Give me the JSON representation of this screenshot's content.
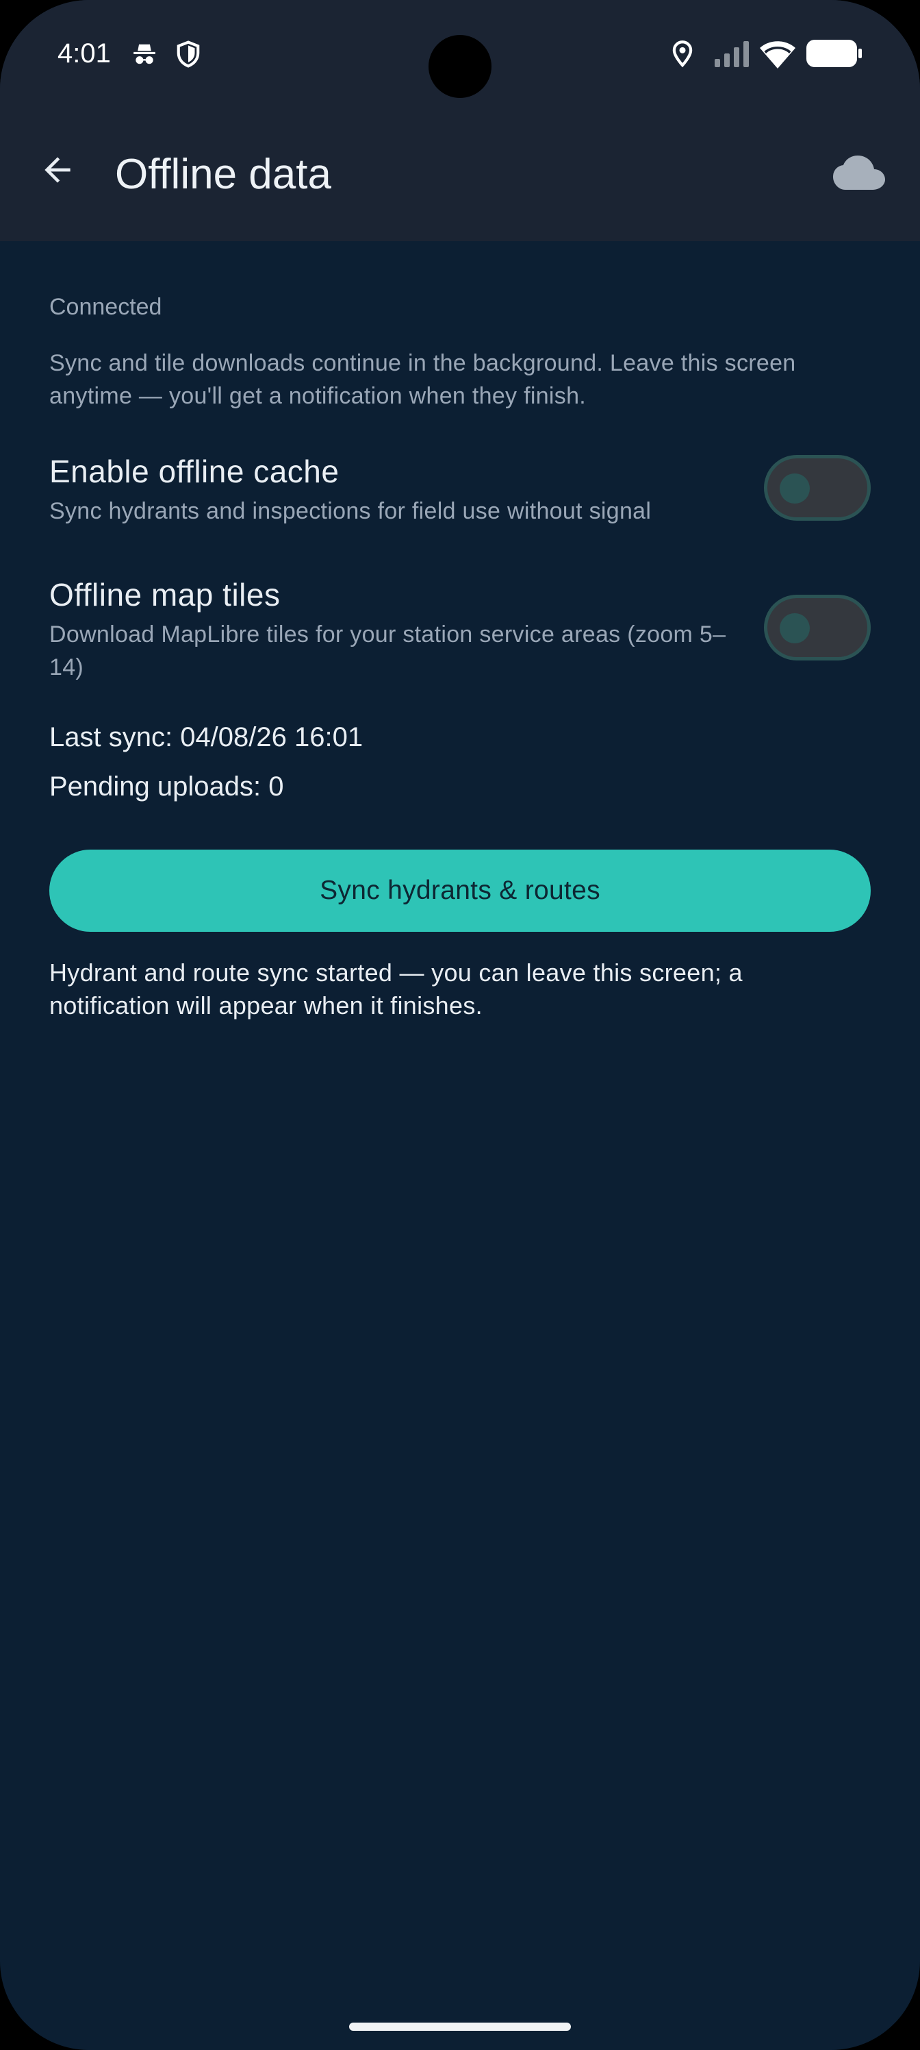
{
  "status_bar": {
    "time": "4:01",
    "icons": [
      "incognito-icon",
      "shield-icon",
      "location-icon",
      "signal-icon",
      "wifi-icon",
      "battery-icon"
    ]
  },
  "app_bar": {
    "title": "Offline data",
    "back_icon": "arrow-left-icon",
    "action_icon": "cloud-icon"
  },
  "connection_status": "Connected",
  "intro_text": "Sync and tile downloads continue in the background. Leave this screen anytime — you'll get a notification when they finish.",
  "settings": [
    {
      "title": "Enable offline cache",
      "description": "Sync hydrants and inspections for field use without signal",
      "enabled": false
    },
    {
      "title": "Offline map tiles",
      "description": "Download MapLibre tiles for your station service areas (zoom 5–14)",
      "enabled": false
    }
  ],
  "last_sync": "Last sync: 04/08/26 16:01",
  "pending_uploads": "Pending uploads: 0",
  "sync_button_label": "Sync hydrants & routes",
  "sync_message": "Hydrant and route sync started — you can leave this screen; a notification will appear when it finishes.",
  "colors": {
    "background": "#0c1f33",
    "app_bar": "#1b2433",
    "accent": "#2ec4b6",
    "secondary_text": "#9aa7b7"
  }
}
